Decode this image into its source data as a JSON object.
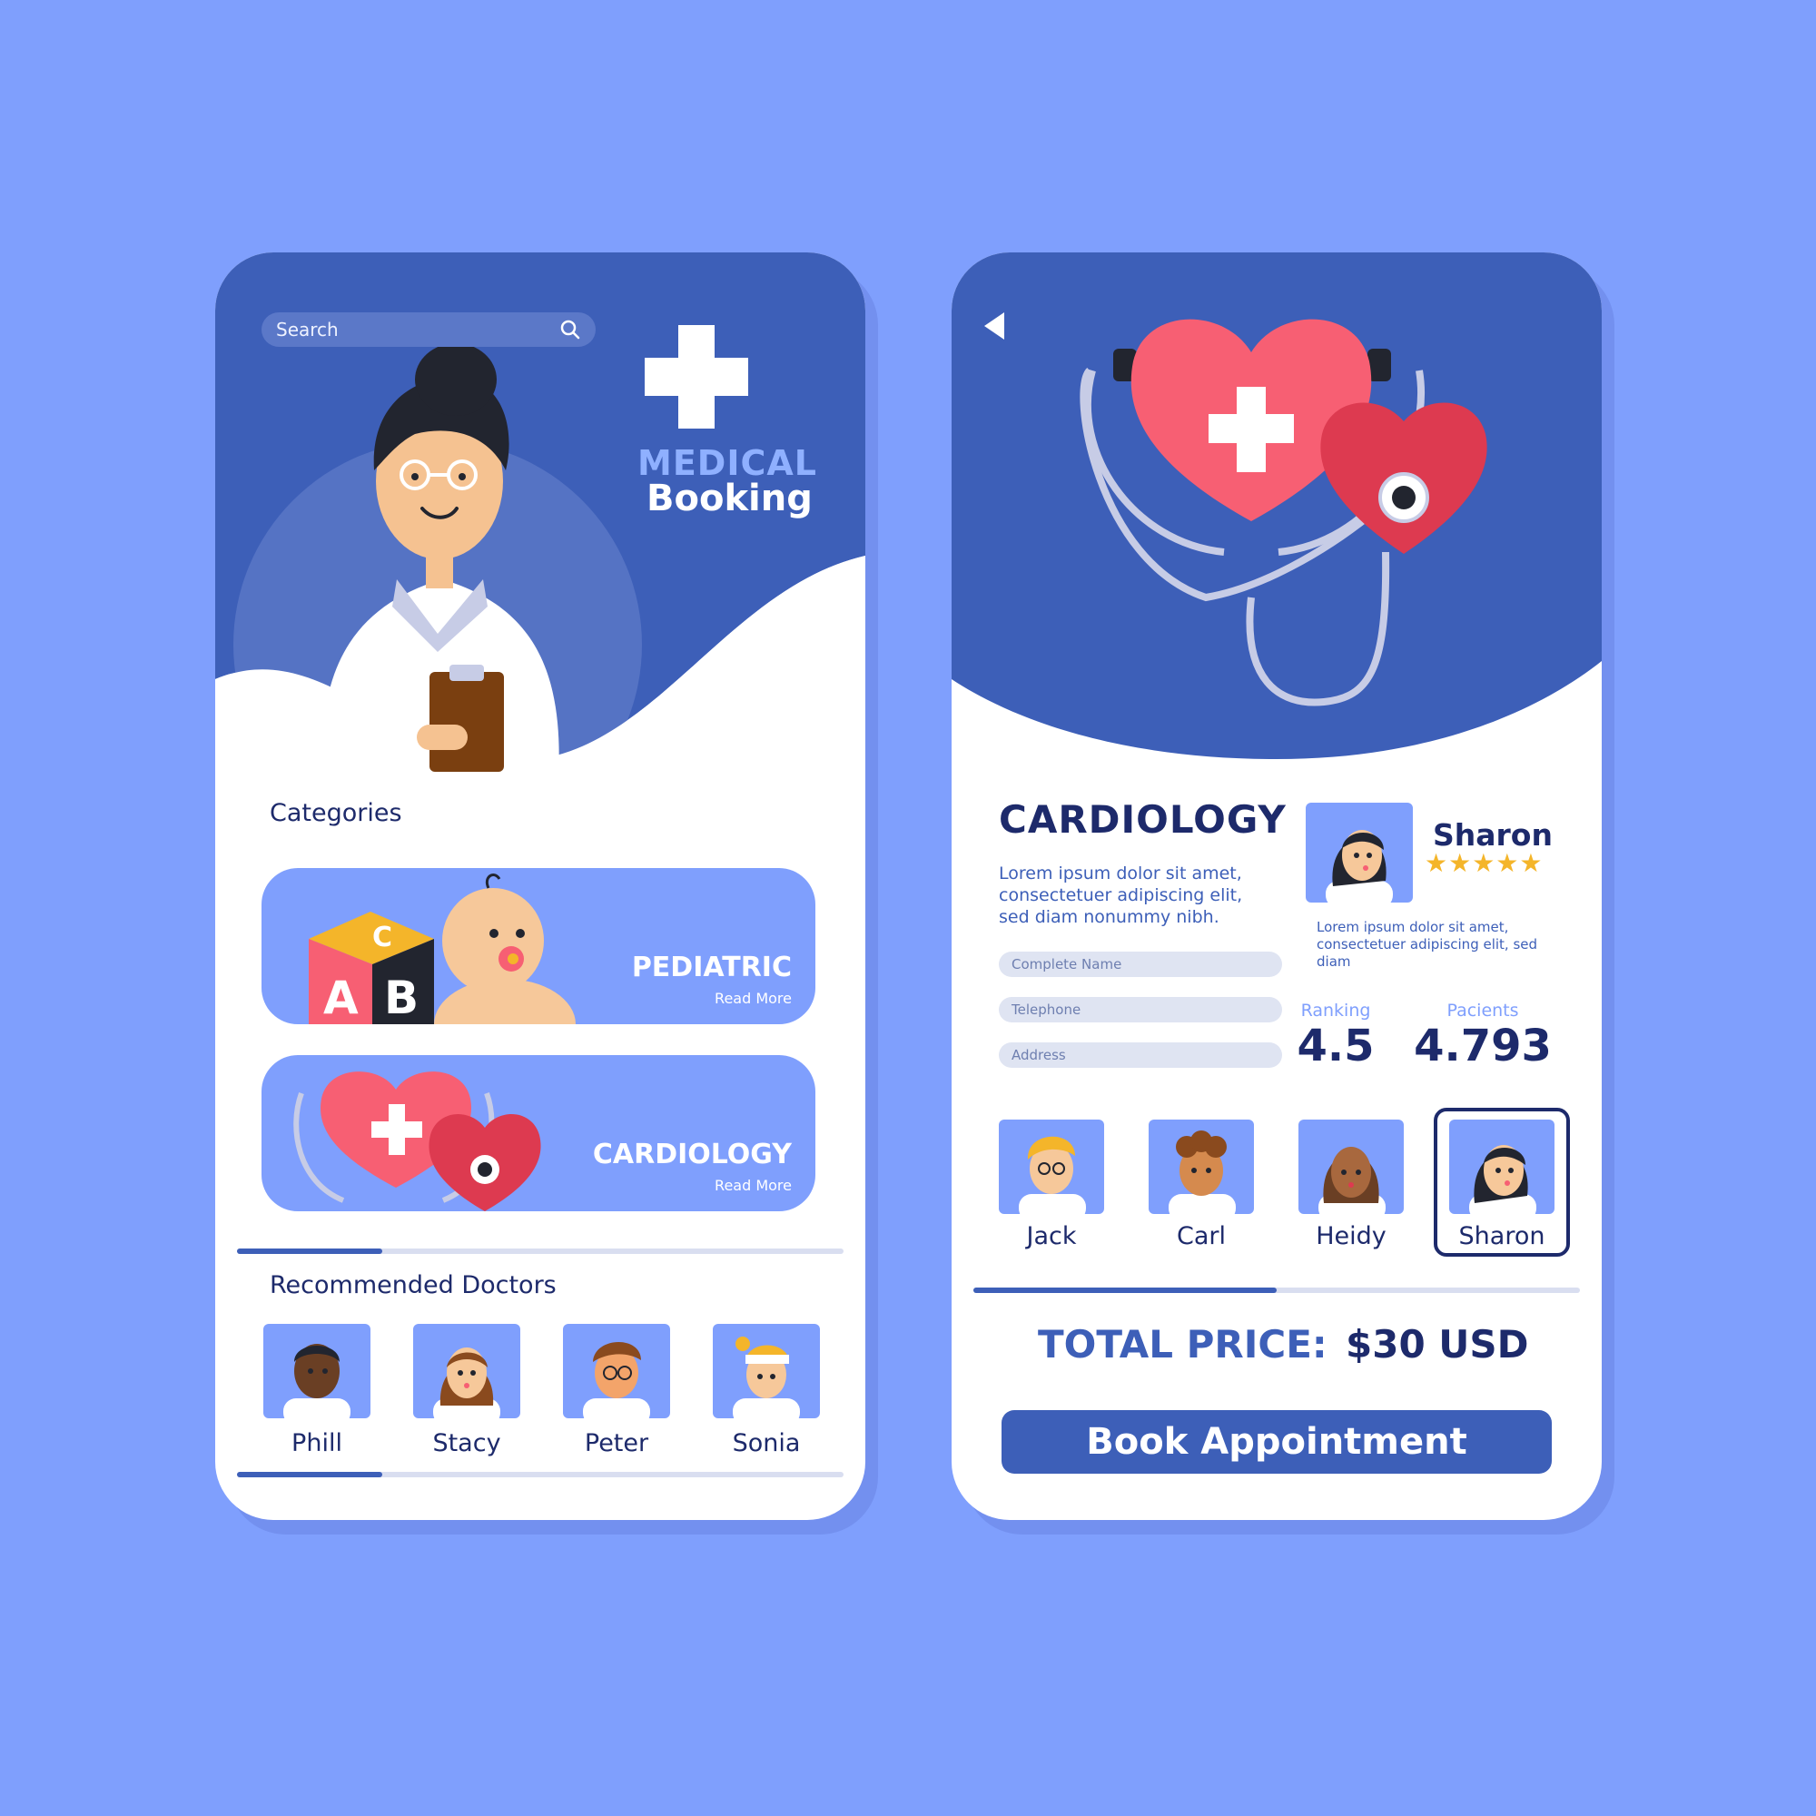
{
  "left_screen": {
    "search": {
      "placeholder": "Search"
    },
    "brand": {
      "line1": "MEDICAL",
      "line2": "Booking"
    },
    "categories_title": "Categories",
    "categories": [
      {
        "title": "PEDIATRIC",
        "link": "Read More"
      },
      {
        "title": "CARDIOLOGY",
        "link": "Read More"
      }
    ],
    "categories_progress": 0.24,
    "recommended_title": "Recommended Doctors",
    "doctors": [
      {
        "name": "Phill"
      },
      {
        "name": "Stacy"
      },
      {
        "name": "Peter"
      },
      {
        "name": "Sonia"
      }
    ],
    "doctors_progress": 0.24
  },
  "right_screen": {
    "title": "CARDIOLOGY",
    "description": "Lorem ipsum dolor sit amet, consectetuer adipiscing elit, sed diam nonummy nibh.",
    "form": {
      "name_placeholder": "Complete Name",
      "phone_placeholder": "Telephone",
      "address_placeholder": "Address"
    },
    "doctor": {
      "name": "Sharon",
      "stars": "★★★★★",
      "rating_stars": 5,
      "bio": "Lorem ipsum dolor sit amet, consectetuer adipiscing elit, sed diam"
    },
    "stats": {
      "ranking_label": "Ranking",
      "ranking_value": "4.5",
      "patients_label": "Pacients",
      "patients_value": "4.793"
    },
    "doctor_choices": [
      {
        "name": "Jack"
      },
      {
        "name": "Carl"
      },
      {
        "name": "Heidy"
      },
      {
        "name": "Sharon",
        "selected": true
      }
    ],
    "choices_progress": 0.5,
    "total": {
      "label": "TOTAL PRICE:",
      "value": "$30 USD"
    },
    "book_button": "Book Appointment"
  },
  "colors": {
    "background": "#7f9ffd",
    "primary": "#3d5fb8",
    "dark_text": "#1d2a6b",
    "heart": "#f75f73",
    "heart_dark": "#dd3a50",
    "star": "#f4b52a"
  }
}
